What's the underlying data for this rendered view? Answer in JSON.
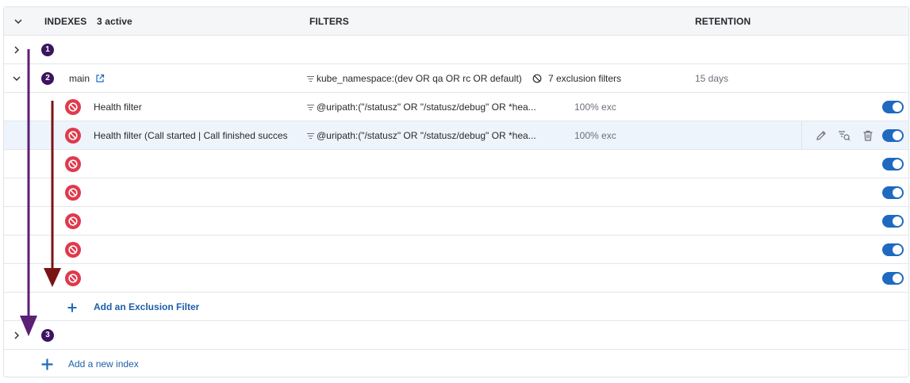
{
  "header": {
    "indexes_label": "INDEXES",
    "active_count": "3 active",
    "filters_label": "FILTERS",
    "retention_label": "RETENTION"
  },
  "indexes": [
    {
      "number": "1"
    },
    {
      "number": "2",
      "name": "main",
      "filter": "kube_namespace:(dev OR qa OR rc OR default)",
      "exclusion_summary": "7 exclusion filters",
      "retention": "15 days"
    },
    {
      "number": "3"
    }
  ],
  "exclusion_filters": [
    {
      "name": "Health filter",
      "query": "@uripath:(\"/statusz\" OR \"/statusz/debug\" OR *hea...",
      "percent": "100% exc",
      "enabled": true
    },
    {
      "name": "Health filter (Call started | Call finished succes",
      "query": "@uripath:(\"/statusz\" OR \"/statusz/debug\" OR *hea...",
      "percent": "100% exc",
      "enabled": true
    },
    {
      "name": "",
      "query": "",
      "percent": "",
      "enabled": true
    },
    {
      "name": "",
      "query": "",
      "percent": "",
      "enabled": true
    },
    {
      "name": "",
      "query": "",
      "percent": "",
      "enabled": true
    },
    {
      "name": "",
      "query": "",
      "percent": "",
      "enabled": true
    },
    {
      "name": "",
      "query": "",
      "percent": "",
      "enabled": true
    }
  ],
  "add_exclusion_label": "Add an Exclusion Filter",
  "add_index_label": "Add a new index",
  "colors": {
    "badge": "#3b1560",
    "block": "#df3a4c",
    "toggle": "#1f69c1",
    "link": "#1f5ea8",
    "arrow_purple": "#5b1f73",
    "arrow_red": "#7a1414"
  },
  "icons": [
    "chevron-down-icon",
    "chevron-right-icon",
    "external-link-icon",
    "funnel-icon",
    "no-entry-icon",
    "block-icon",
    "pencil-icon",
    "filter-search-icon",
    "trash-icon",
    "plus-icon",
    "toggle-switch"
  ]
}
